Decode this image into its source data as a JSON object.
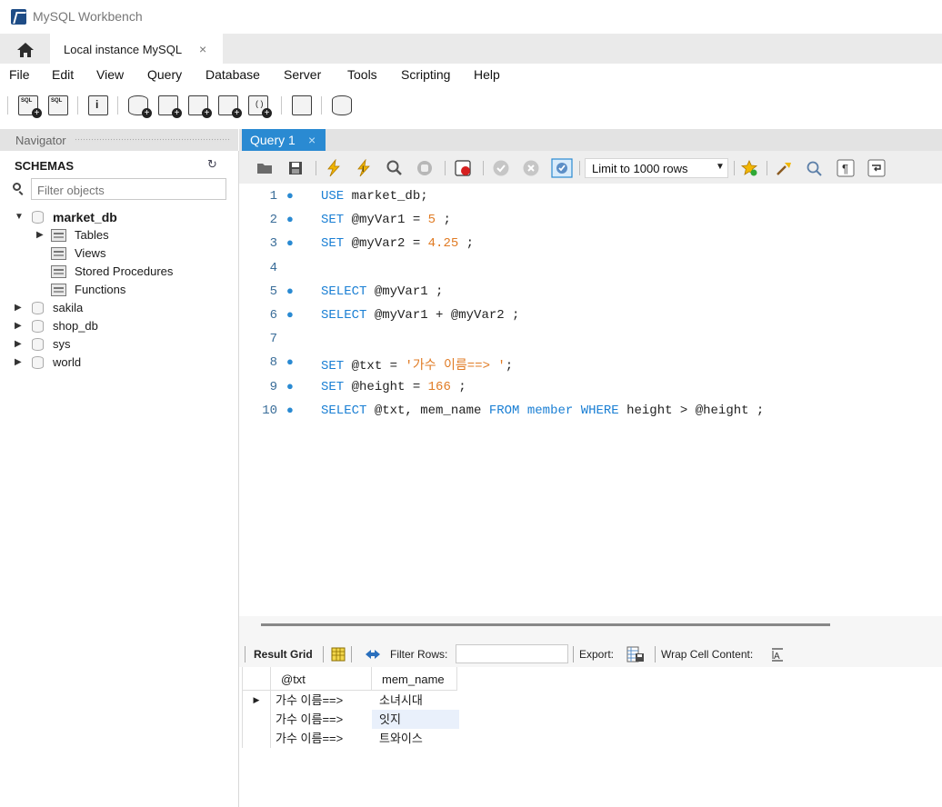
{
  "window": {
    "title": "MySQL Workbench"
  },
  "tabs": {
    "connection_label": "Local instance MySQL",
    "close": "×"
  },
  "menu": [
    "File",
    "Edit",
    "View",
    "Query",
    "Database",
    "Server",
    "Tools",
    "Scripting",
    "Help"
  ],
  "toolbar": {
    "icons": [
      "new-sql-tab-icon",
      "open-sql-script-icon",
      "schema-inspector-icon",
      "create-schema-icon",
      "create-table-icon",
      "create-view-icon",
      "create-procedure-icon",
      "create-function-icon",
      "search-table-data-icon",
      "reconnect-icon"
    ]
  },
  "navigator": {
    "header": "Navigator",
    "schemas_title": "SCHEMAS",
    "filter_placeholder": "Filter objects",
    "schemas": [
      {
        "name": "market_db",
        "expanded": true,
        "children": [
          "Tables",
          "Views",
          "Stored Procedures",
          "Functions"
        ]
      },
      {
        "name": "sakila"
      },
      {
        "name": "shop_db"
      },
      {
        "name": "sys"
      },
      {
        "name": "world"
      }
    ]
  },
  "query_tab": {
    "label": "Query 1",
    "close": "×"
  },
  "editor_toolbar": {
    "limit_label": "Limit to 1000 rows"
  },
  "editor": {
    "lines": [
      {
        "n": "1",
        "tokens": [
          [
            "kw",
            "USE"
          ],
          [
            "t",
            " market_db;"
          ]
        ]
      },
      {
        "n": "2",
        "tokens": [
          [
            "kw",
            "SET"
          ],
          [
            "t",
            " @myVar1 = "
          ],
          [
            "num",
            "5"
          ],
          [
            "t",
            " ;"
          ]
        ]
      },
      {
        "n": "3",
        "tokens": [
          [
            "kw",
            "SET"
          ],
          [
            "t",
            " @myVar2 = "
          ],
          [
            "num",
            "4.25"
          ],
          [
            "t",
            " ;"
          ]
        ]
      },
      {
        "n": "4",
        "tokens": []
      },
      {
        "n": "5",
        "tokens": [
          [
            "kw",
            "SELECT"
          ],
          [
            "t",
            " @myVar1 ;"
          ]
        ]
      },
      {
        "n": "6",
        "tokens": [
          [
            "kw",
            "SELECT"
          ],
          [
            "t",
            " @myVar1 + @myVar2 ;"
          ]
        ]
      },
      {
        "n": "7",
        "tokens": []
      },
      {
        "n": "8",
        "tokens": [
          [
            "kw",
            "SET"
          ],
          [
            "t",
            " @txt = "
          ],
          [
            "str",
            "'가수 이름==> '"
          ],
          [
            "t",
            ";"
          ]
        ]
      },
      {
        "n": "9",
        "tokens": [
          [
            "kw",
            "SET"
          ],
          [
            "t",
            " @height = "
          ],
          [
            "num",
            "166"
          ],
          [
            "t",
            " ;"
          ]
        ]
      },
      {
        "n": "10",
        "tokens": [
          [
            "kw",
            "SELECT"
          ],
          [
            "t",
            " @txt, mem_name "
          ],
          [
            "kw",
            "FROM"
          ],
          [
            "t",
            " "
          ],
          [
            "kw",
            "member"
          ],
          [
            "t",
            " "
          ],
          [
            "kw",
            "WHERE"
          ],
          [
            "t",
            " height > @height ;"
          ]
        ]
      }
    ]
  },
  "result_toolbar": {
    "result_grid": "Result Grid",
    "filter_rows": "Filter Rows:",
    "export": "Export:",
    "wrap": "Wrap Cell Content:"
  },
  "result": {
    "columns": [
      "@txt",
      "mem_name"
    ],
    "rows": [
      [
        "가수 이름==>",
        "소녀시대"
      ],
      [
        "가수 이름==>",
        "잇지"
      ],
      [
        "가수 이름==>",
        "트와이스"
      ]
    ]
  }
}
